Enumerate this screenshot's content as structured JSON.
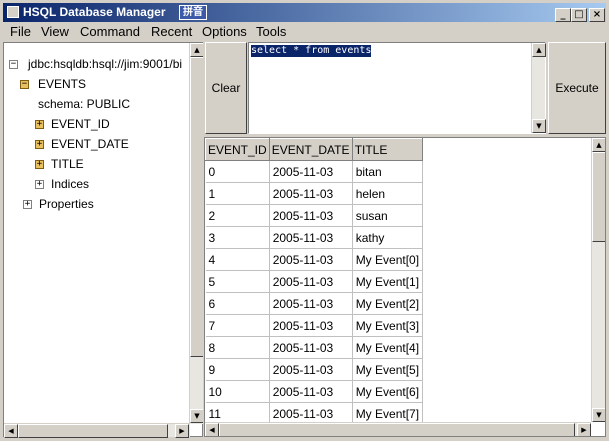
{
  "window": {
    "title": "HSQL Database Manager",
    "ime_label": "拼音",
    "min_glyph": "_",
    "max_glyph": "□",
    "close_glyph": "×"
  },
  "menu": [
    "File",
    "View",
    "Command",
    "Recent",
    "Options",
    "Tools"
  ],
  "tree": {
    "root": "jdbc:hsqldb:hsql://jim:9001/bi",
    "table": "EVENTS",
    "schema": "schema: PUBLIC",
    "columns": [
      "EVENT_ID",
      "EVENT_DATE",
      "TITLE"
    ],
    "indices": "Indices",
    "properties": "Properties",
    "expand_glyph": "+",
    "collapse_glyph": "−"
  },
  "query": {
    "clear_label": "Clear",
    "execute_label": "Execute",
    "sql": "select * from events"
  },
  "results": {
    "headers": [
      "EVENT_ID",
      "EVENT_DATE",
      "TITLE"
    ],
    "rows": [
      [
        "0",
        "2005-11-03",
        "bitan"
      ],
      [
        "1",
        "2005-11-03",
        "helen"
      ],
      [
        "2",
        "2005-11-03",
        "susan"
      ],
      [
        "3",
        "2005-11-03",
        "kathy"
      ],
      [
        "4",
        "2005-11-03",
        "My Event[0]"
      ],
      [
        "5",
        "2005-11-03",
        "My Event[1]"
      ],
      [
        "6",
        "2005-11-03",
        "My Event[2]"
      ],
      [
        "7",
        "2005-11-03",
        "My Event[3]"
      ],
      [
        "8",
        "2005-11-03",
        "My Event[4]"
      ],
      [
        "9",
        "2005-11-03",
        "My Event[5]"
      ],
      [
        "10",
        "2005-11-03",
        "My Event[6]"
      ],
      [
        "11",
        "2005-11-03",
        "My Event[7]"
      ]
    ]
  }
}
